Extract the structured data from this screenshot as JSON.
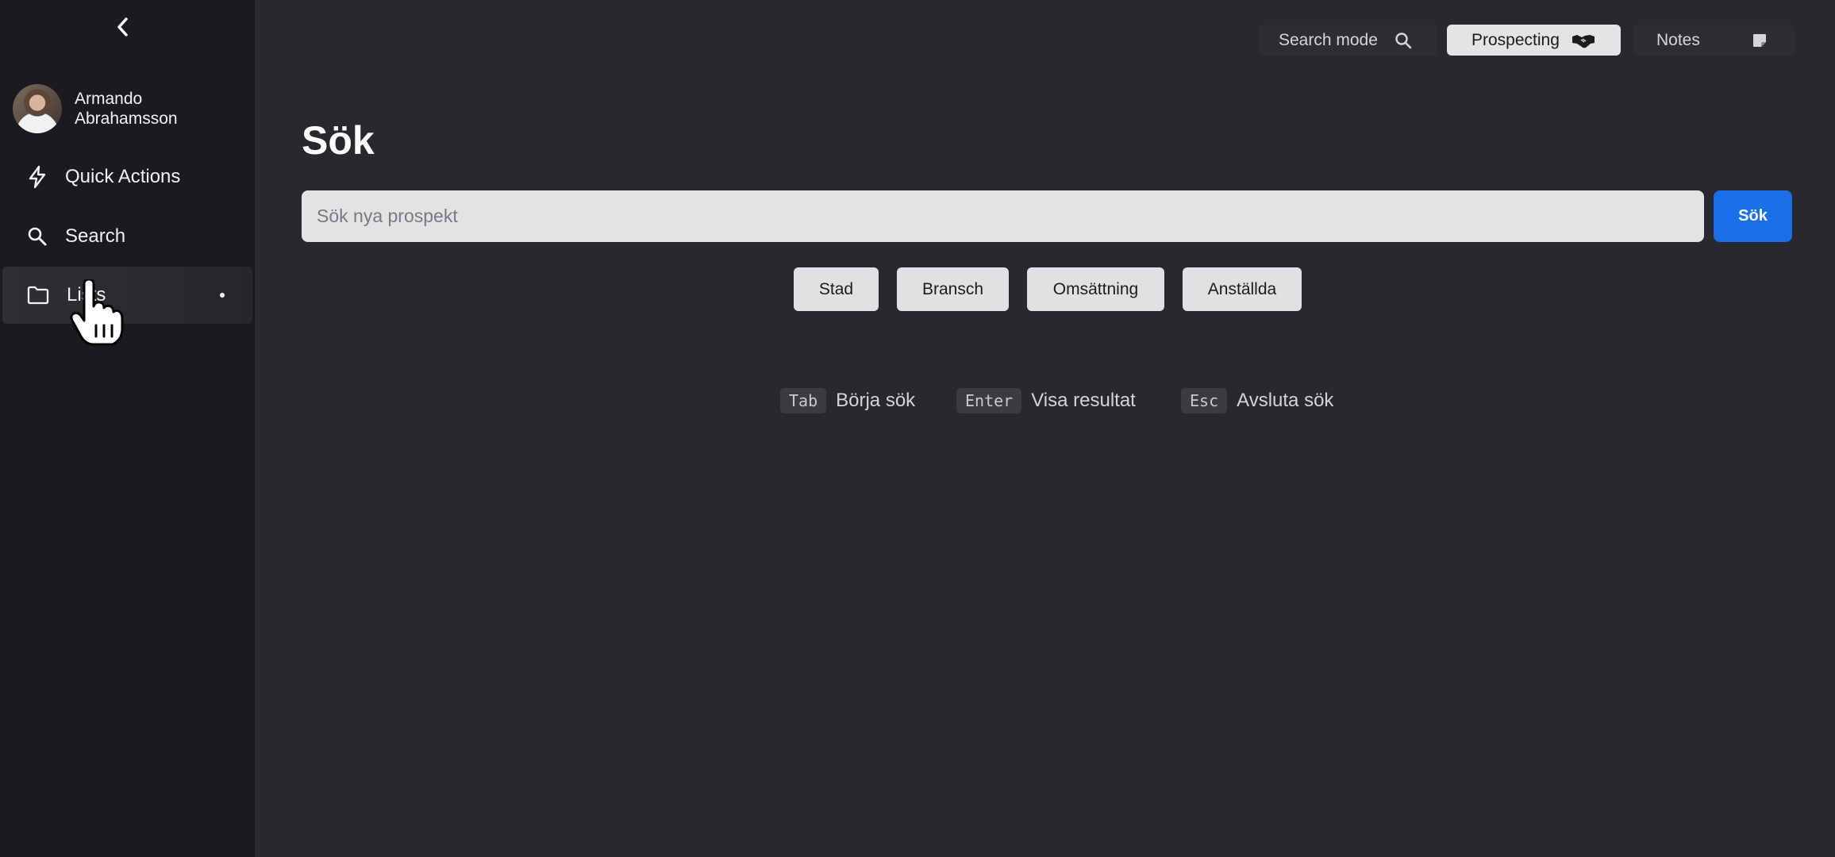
{
  "sidebar": {
    "user": {
      "name": "Armando Abrahamsson"
    },
    "items": [
      {
        "label": "Quick Actions",
        "icon": "lightning-icon"
      },
      {
        "label": "Search",
        "icon": "search-icon"
      },
      {
        "label": "Lists",
        "icon": "folder-icon",
        "active": true
      }
    ]
  },
  "topbar": {
    "modes": [
      {
        "label": "Search mode",
        "icon": "search-icon"
      },
      {
        "label": "Prospecting",
        "icon": "handshake-icon",
        "active": true
      },
      {
        "label": "Notes",
        "icon": "note-icon"
      }
    ]
  },
  "main": {
    "title": "Sök",
    "search": {
      "placeholder": "Sök nya prospekt",
      "value": "",
      "button_label": "Sök"
    },
    "filters": [
      "Stad",
      "Bransch",
      "Omsättning",
      "Anställda"
    ],
    "hints": [
      {
        "key": "Tab",
        "text": "Börja sök"
      },
      {
        "key": "Enter",
        "text": "Visa resultat"
      },
      {
        "key": "Esc",
        "text": "Avsluta sök"
      }
    ]
  },
  "colors": {
    "background": "#28292e",
    "sidebar": "#1b1b1f",
    "accent": "#1b6fe6"
  }
}
